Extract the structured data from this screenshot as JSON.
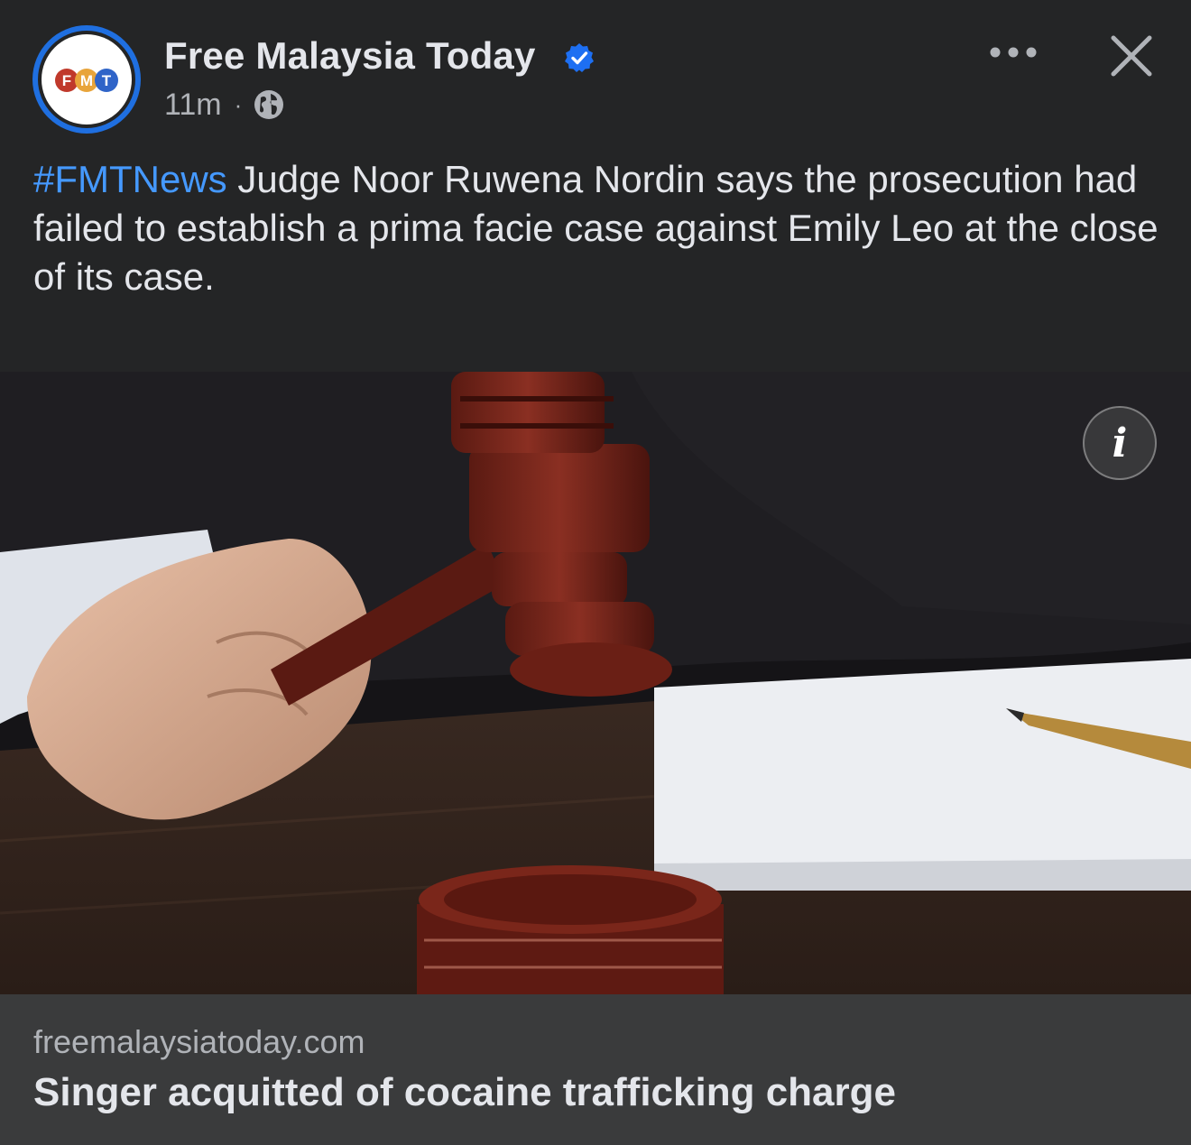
{
  "header": {
    "page_name": "Free Malaysia Today",
    "timestamp": "11m",
    "separator": "·",
    "avatar_logo_letters": [
      "F",
      "M",
      "T"
    ],
    "verified_icon": "verified-badge-icon",
    "audience_icon": "globe-icon",
    "more_icon": "more-options-icon",
    "close_icon": "close-icon"
  },
  "post": {
    "hashtag": "#FMTNews",
    "body": " Judge Noor Ruwena Nordin says the prosecution had failed to establish a prima facie case against Emily Leo at the close of its case."
  },
  "media": {
    "info_label": "i",
    "info_icon": "info-icon"
  },
  "link_preview": {
    "domain": "freemalaysiatoday.com",
    "headline": "Singer acquitted of cocaine trafficking charge"
  },
  "colors": {
    "background": "#242526",
    "footer": "#3a3b3c",
    "hashtag": "#4599ff",
    "verified": "#1d6ff2",
    "avatar_ring": "#1f6fe0"
  }
}
